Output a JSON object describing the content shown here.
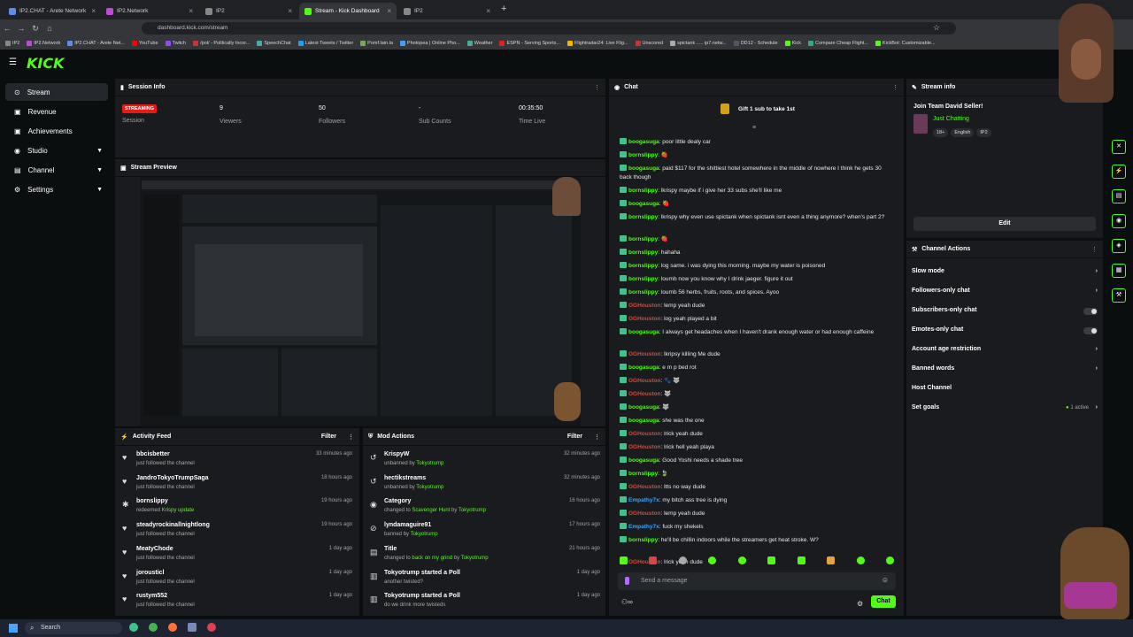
{
  "browser": {
    "tabs": [
      {
        "label": "IP2.CHAT - Arete Network",
        "active": false
      },
      {
        "label": "IP2.Network",
        "active": false
      },
      {
        "label": "IP2",
        "active": false
      },
      {
        "label": "Stream - Kick Dashboard",
        "active": true
      },
      {
        "label": "IP2",
        "active": false
      }
    ],
    "url": "dashboard.kick.com/stream",
    "bookmarks": [
      "IP2",
      "IP2.Network",
      "IP2.CHAT - Arete Net...",
      "YouTube",
      "Twitch",
      "/pol/ - Politically Incor...",
      "SpeechChat",
      "Latest Tweets / Twitter",
      "Pomf.lain.la",
      "Photopea | Online Pho...",
      "Weather",
      "ESPN - Serving Sports...",
      "Flightradar24: Live Flig...",
      "Unscored",
      "spictank ..... ip7.netw...",
      "DD12 - Schedule",
      "Kick",
      "Compare Cheap Flight...",
      "KickBot: Customizable..."
    ]
  },
  "brand": {
    "logo": "KICK",
    "accent": "#53fc18"
  },
  "sidebar": {
    "items": [
      {
        "label": "Stream",
        "icon": "broadcast-icon",
        "active": true,
        "expand": false
      },
      {
        "label": "Revenue",
        "icon": "wallet-icon",
        "expand": false
      },
      {
        "label": "Achievements",
        "icon": "trophy-icon",
        "expand": false
      },
      {
        "label": "Studio",
        "icon": "studio-icon",
        "expand": true
      },
      {
        "label": "Channel",
        "icon": "channel-icon",
        "expand": true
      },
      {
        "label": "Settings",
        "icon": "gear-icon",
        "expand": true
      }
    ]
  },
  "session": {
    "title": "Session Info",
    "status": "STREAMING",
    "status_label": "Session",
    "viewers": "9",
    "viewers_label": "Viewers",
    "followers": "50",
    "followers_label": "Followers",
    "subs": "-",
    "subs_label": "Sub Counts",
    "time": "00:35:50",
    "time_label": "Time Live"
  },
  "preview": {
    "title": "Stream Preview"
  },
  "activity": {
    "title": "Activity Feed",
    "filter": "Filter",
    "items": [
      {
        "name": "bbcisbetter",
        "action": "just followed the channel",
        "time": "33 minutes ago",
        "icon": "heart-icon"
      },
      {
        "name": "JandroTokyoTrumpSaga",
        "action": "just followed the channel",
        "time": "18 hours ago",
        "icon": "heart-icon"
      },
      {
        "name": "bornslippy",
        "action": "redeemed ",
        "extra": "Krispy update",
        "time": "19 hours ago",
        "icon": "reward-icon"
      },
      {
        "name": "steadyrockinallnightlong",
        "action": "just followed the channel",
        "time": "19 hours ago",
        "icon": "heart-icon"
      },
      {
        "name": "MeatyChode",
        "action": "just followed the channel",
        "time": "1 day ago",
        "icon": "heart-icon"
      },
      {
        "name": "jorousticl",
        "action": "just followed the channel",
        "time": "1 day ago",
        "icon": "heart-icon"
      },
      {
        "name": "rustym552",
        "action": "just followed the channel",
        "time": "1 day ago",
        "icon": "heart-icon"
      }
    ]
  },
  "mod": {
    "title": "Mod Actions",
    "filter": "Filter",
    "items": [
      {
        "name": "KrispyW",
        "action": "unbanned by ",
        "by": "Tokyotrump",
        "time": "32 minutes ago",
        "icon": "undo-icon"
      },
      {
        "name": "hectikstreams",
        "action": "unbanned by ",
        "by": "Tokyotrump",
        "time": "32 minutes ago",
        "icon": "undo-icon"
      },
      {
        "name": "Category",
        "action": "changed to ",
        "extra": "Scavenger Hunt",
        "by2": " by ",
        "by": "Tokyotrump",
        "time": "16 hours ago",
        "icon": "category-icon"
      },
      {
        "name": "lyndamaguire91",
        "action": "banned by ",
        "by": "Tokyotrump",
        "time": "17 hours ago",
        "icon": "ban-icon"
      },
      {
        "name": "Title",
        "action": "changed to ",
        "extra": "back on my grind",
        "by2": " by ",
        "by": "Tokyotrump",
        "time": "21 hours ago",
        "icon": "title-icon"
      },
      {
        "name": "Tokyotrump started a Poll",
        "action": "another twisted?",
        "time": "1 day ago",
        "icon": "poll-icon"
      },
      {
        "name": "Tokyotrump started a Poll",
        "action": "do we drink more twisteds",
        "time": "1 day ago",
        "icon": "poll-icon"
      }
    ]
  },
  "chat": {
    "title": "Chat",
    "gift": "Gift 1 sub to take 1st",
    "placeholder": "Send a message",
    "send": "Chat",
    "messages": [
      {
        "user": "boogasuga",
        "c": "g",
        "text": "poor little dealy car"
      },
      {
        "user": "bornslippy",
        "c": "g",
        "text": "🍓"
      },
      {
        "user": "boogasuga",
        "c": "g",
        "text": "paid $117 for the shittiest hotel somewhere in the middle of nowhere I think he gets 30 back though"
      },
      {
        "user": "bornslippy",
        "c": "g",
        "text": "lkrispy maybe if i give her 33 subs she'll like me"
      },
      {
        "user": "boogasuga",
        "c": "g",
        "text": "🍓"
      },
      {
        "user": "bornslippy",
        "c": "g",
        "text": "lkrispy why even use spictank when spictank isnt even a thing anymore? when's part 2?"
      },
      {
        "user": "bornslippy",
        "c": "g",
        "text": "🍓"
      },
      {
        "user": "bornslippy",
        "c": "g",
        "text": "hahaha"
      },
      {
        "user": "bornslippy",
        "c": "g",
        "text": "log same. i was dying this morning. maybe my water is poisoned"
      },
      {
        "user": "bornslippy",
        "c": "g",
        "text": "loumb now you know why I drink jaeger. figure it out"
      },
      {
        "user": "bornslippy",
        "c": "g",
        "text": "loumb 56 herbs, fruits, roots, and spices. Ayoo"
      },
      {
        "user": "OGHouston",
        "c": "r",
        "text": "lemp yeah dude"
      },
      {
        "user": "OGHouston",
        "c": "r",
        "text": "log yeah played a bit"
      },
      {
        "user": "boogasuga",
        "c": "g",
        "text": "I always get headaches when I haven't drank enough water or had enough caffeine"
      },
      {
        "user": "OGHouston",
        "c": "r",
        "text": "lkripsy killing Me dude"
      },
      {
        "user": "boogasuga",
        "c": "g",
        "text": "e m p bed rot"
      },
      {
        "user": "OGHouston",
        "c": "r",
        "text": "🐾 🐺"
      },
      {
        "user": "OGHouston",
        "c": "r",
        "text": "🐺"
      },
      {
        "user": "boogasuga",
        "c": "g",
        "text": "🐺"
      },
      {
        "user": "boogasuga",
        "c": "g",
        "text": "she was the one"
      },
      {
        "user": "OGHouston",
        "c": "r",
        "text": "lrick yeah dude"
      },
      {
        "user": "OGHouston",
        "c": "r",
        "text": "lrick hell yeah playa"
      },
      {
        "user": "boogasuga",
        "c": "g",
        "text": "Good Yoshi needs a shade tree"
      },
      {
        "user": "bornslippy",
        "c": "g",
        "text": "🍃"
      },
      {
        "user": "OGHouston",
        "c": "r",
        "text": "ltts no way dude"
      },
      {
        "user": "Empathy7x",
        "c": "b",
        "text": "my bitch ass tree is dying"
      },
      {
        "user": "OGHouston",
        "c": "r",
        "text": "lemp yeah dude"
      },
      {
        "user": "Empathy7x",
        "c": "b",
        "text": "fuck my shekels"
      },
      {
        "user": "bornslippy",
        "c": "g",
        "text": "he'll be chillin indoors while the streamers get heat stroke. W?"
      },
      {
        "user": "OGHouston",
        "c": "r",
        "text": "lrick yeah dude"
      }
    ]
  },
  "streaminfo": {
    "title": "Stream info",
    "stream_title": "Join Team David Seller!",
    "category": "Just Chatting",
    "tags": [
      "18+",
      "English",
      "IP2"
    ],
    "edit": "Edit"
  },
  "actions": {
    "title": "Channel Actions",
    "items": [
      {
        "label": "Slow mode",
        "type": "arrow"
      },
      {
        "label": "Followers-only chat",
        "type": "arrow"
      },
      {
        "label": "Subscribers-only chat",
        "type": "toggle"
      },
      {
        "label": "Emotes-only chat",
        "type": "toggle"
      },
      {
        "label": "Account age restriction",
        "type": "arrow"
      },
      {
        "label": "Banned words",
        "type": "arrow"
      },
      {
        "label": "Host Channel",
        "type": "none"
      },
      {
        "label": "Set goals",
        "type": "arrow",
        "extra": "1 active"
      }
    ]
  },
  "taskbar": {
    "search": "Search"
  }
}
